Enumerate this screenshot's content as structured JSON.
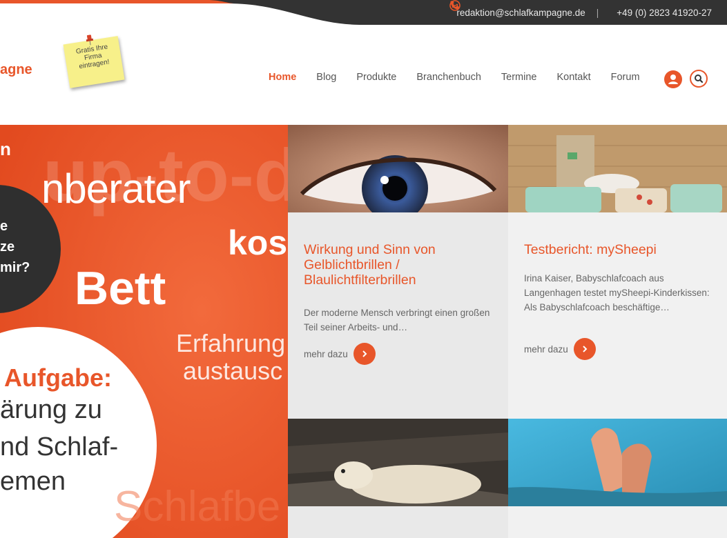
{
  "topbar": {
    "email": "redaktion@schlafkampagne.de",
    "separator": "|",
    "phone": "+49 (0) 2823 41920-27"
  },
  "logo": {
    "text": "agne"
  },
  "sticky_note": {
    "line1": "Gratis Ihre",
    "line2": "Firma",
    "line3": "eintragen!"
  },
  "nav": {
    "items": [
      "Home",
      "Blog",
      "Produkte",
      "Branchenbuch",
      "Termine",
      "Kontakt",
      "Forum"
    ],
    "active": "Home"
  },
  "hero": {
    "text_n": "n",
    "text_uptod": "up-to-d",
    "text_nberater": "nberater",
    "text_kos": "kos",
    "text_bett": "Bett",
    "text_e": "e",
    "text_ze": "ze",
    "text_mir": "mir?",
    "text_erfahrung": "Erfahrung",
    "text_austausc": "austausc",
    "text_aufgabe": "Aufgabe:",
    "text_arung_zu": "ärung zu",
    "text_nd_schlaf": "nd Schlaf-",
    "text_emen": "emen",
    "text_schlafbe": "Schlafbe"
  },
  "tiles": [
    {
      "title": "Wirkung und Sinn von Gelblichtbrillen / Blaulichtfilterbrillen",
      "text": "Der moderne Mensch verbringt einen großen Teil seiner Arbeits- und…",
      "more": "mehr dazu"
    },
    {
      "title": "Testbericht: mySheepi",
      "text": "Irina Kaiser, Babyschlafcoach aus Langenhagen testet mySheepi-Kinderkissen: Als Babyschlafcoach beschäftige…",
      "more": "mehr dazu"
    }
  ],
  "colors": {
    "accent": "#e8562a",
    "topbar_bg": "#333333",
    "tile_bg": "#e9e9e9",
    "tile_bg_alt": "#f1f1f1"
  },
  "icons": [
    "mail-icon",
    "phone-icon",
    "user-icon",
    "search-icon",
    "chevron-right-icon",
    "pin-icon"
  ]
}
